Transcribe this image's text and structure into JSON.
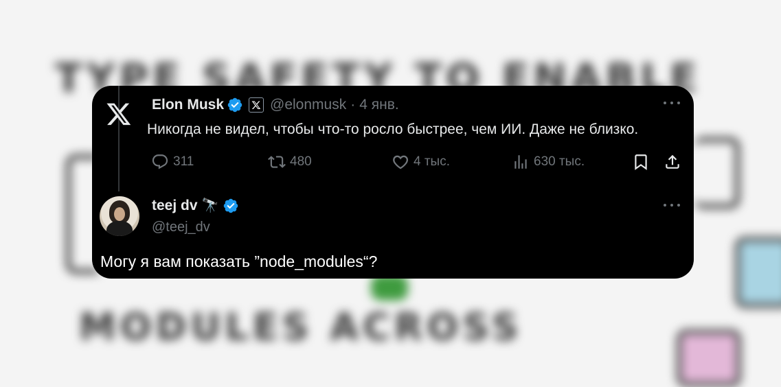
{
  "background": {
    "scribbles": [
      "TYPE SAFETY TO ENABLE",
      "MODULES ACROSS"
    ]
  },
  "quoted_tweet": {
    "platform_icon": "x-logo-icon",
    "author_name": "Elon Musk",
    "handle": "@elonmusk",
    "separator": "·",
    "date": "4 янв.",
    "text": "Никогда не видел, чтобы что-то росло быстрее, чем ИИ. Даже не близко.",
    "replies": "311",
    "reposts": "480",
    "likes": "4 тыс.",
    "views": "630 тыс.",
    "verified_color": "#1d9bf0"
  },
  "reply_tweet": {
    "author_name": "teej dv",
    "name_emoji": "🔭",
    "handle": "@teej_dv",
    "text": "Могу я вам показать ”node_modules“?"
  }
}
